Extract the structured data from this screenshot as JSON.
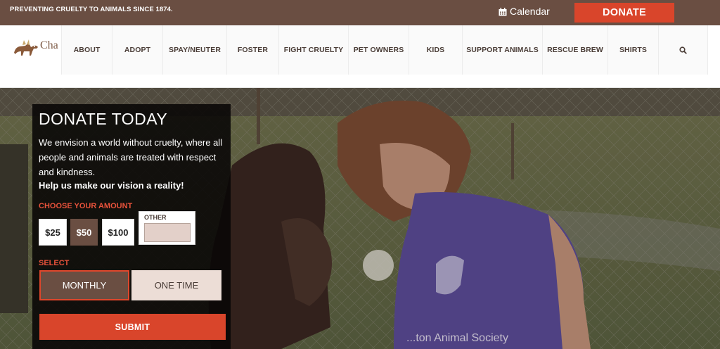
{
  "topbar": {
    "tagline": "PREVENTING CRUELTY TO ANIMALS SINCE 1874.",
    "calendar_label": "Calendar",
    "donate_label": "DONATE"
  },
  "logo": {
    "text": "Cha"
  },
  "nav": {
    "items": [
      {
        "label": "ABOUT"
      },
      {
        "label": "ADOPT"
      },
      {
        "label": "SPAY/NEUTER"
      },
      {
        "label": "FOSTER"
      },
      {
        "label": "FIGHT CRUELTY"
      },
      {
        "label": "PET OWNERS"
      },
      {
        "label": "KIDS"
      },
      {
        "label": "SUPPORT ANIMALS"
      },
      {
        "label": "RESCUE BREW"
      },
      {
        "label": "SHIRTS"
      }
    ],
    "search_icon": "search-icon"
  },
  "hero": {
    "shirt_text": "...ton Animal Society"
  },
  "donate_panel": {
    "title": "DONATE TODAY",
    "description": "We envision a world without cruelty, where all people and animals are treated with respect and kindness.",
    "cta": "Help us make our vision a reality!",
    "choose_label": "CHOOSE YOUR AMOUNT",
    "amounts": [
      {
        "label": "$25",
        "selected": false
      },
      {
        "label": "$50",
        "selected": true
      },
      {
        "label": "$100",
        "selected": false
      }
    ],
    "other_label": "OTHER",
    "other_value": "",
    "select_label": "SELECT",
    "frequency": {
      "monthly": "MONTHLY",
      "one_time": "ONE TIME",
      "selected": "monthly"
    },
    "submit_label": "SUBMIT"
  },
  "colors": {
    "brand_brown": "#6a4e42",
    "accent_red": "#d9452b",
    "label_red": "#e8523b"
  }
}
